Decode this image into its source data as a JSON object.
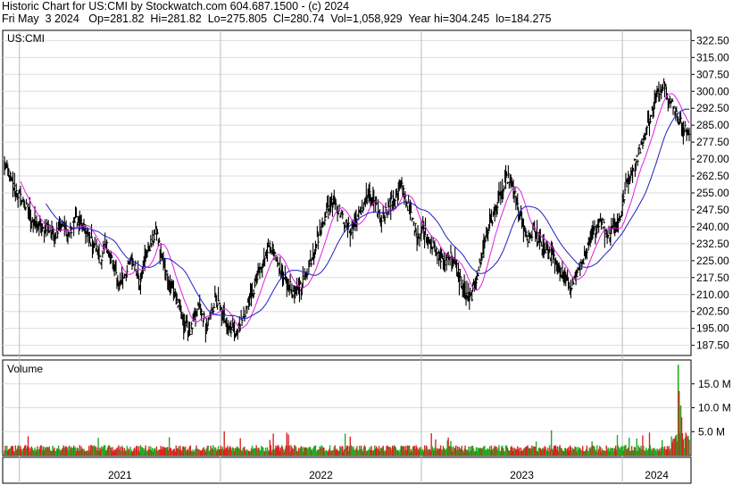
{
  "header": {
    "line1": "Historic Chart for US:CMI by Stockwatch.com 604.687.1500 - (c) 2024",
    "line2": "Fri May  3 2024   Op=281.82  Hi=281.82  Lo=275.805  Cl=280.74  Vol=1,058,929  Year hi=304.245  lo=184.275"
  },
  "chart_data": {
    "type": "line",
    "symbol": "US:CMI",
    "price_axis": {
      "range": [
        183,
        327
      ],
      "ticks": [
        "322.50",
        "315.00",
        "307.50",
        "300.00",
        "292.50",
        "285.00",
        "277.50",
        "270.00",
        "262.50",
        "255.00",
        "247.50",
        "240.00",
        "232.50",
        "225.00",
        "217.50",
        "210.00",
        "202.50",
        "195.00",
        "187.50"
      ]
    },
    "volume_axis": {
      "title": "Volume",
      "range": [
        0,
        20000000
      ],
      "ticks": [
        "15.0 M",
        "10.0 M",
        "5.0 M"
      ]
    },
    "x_axis": {
      "labels": [
        "2021",
        "2022",
        "2023",
        "2024"
      ]
    },
    "grid": true,
    "price_series_weekly": {
      "name": "US:CMI",
      "start": "2020-12",
      "end": "2024-05-03",
      "close": [
        268,
        264,
        258,
        255,
        252,
        249,
        245,
        242,
        240,
        238,
        241,
        238,
        236,
        242,
        240,
        236,
        239,
        244,
        241,
        238,
        235,
        232,
        229,
        226,
        232,
        228,
        222,
        214,
        218,
        220,
        226,
        222,
        216,
        225,
        230,
        234,
        238,
        228,
        222,
        215,
        212,
        206,
        200,
        196,
        194,
        199,
        205,
        200,
        196,
        202,
        208,
        204,
        200,
        196,
        195,
        193,
        198,
        202,
        208,
        212,
        218,
        223,
        230,
        232,
        226,
        220,
        218,
        215,
        212,
        210,
        214,
        218,
        222,
        228,
        234,
        240,
        246,
        250,
        252,
        248,
        244,
        240,
        238,
        242,
        246,
        250,
        254,
        252,
        248,
        244,
        246,
        250,
        252,
        255,
        258,
        252,
        246,
        240,
        236,
        240,
        236,
        232,
        229,
        226,
        224,
        228,
        226,
        222,
        216,
        210,
        207,
        212,
        220,
        228,
        236,
        242,
        246,
        252,
        256,
        262,
        258,
        252,
        245,
        238,
        234,
        238,
        236,
        232,
        230,
        228,
        226,
        222,
        218,
        216,
        214,
        217,
        222,
        226,
        230,
        235,
        240,
        244,
        239,
        236,
        242,
        240,
        247,
        258,
        263,
        268,
        272,
        278,
        284,
        290,
        296,
        301,
        304,
        298,
        294,
        290,
        286,
        283,
        281
      ],
      "ma_fast": {
        "color": "#e020e0"
      },
      "ma_slow": {
        "color": "#2020c0"
      }
    },
    "volume_colors": {
      "up": "#22aa22",
      "down": "#dd2222"
    },
    "volume_spikes_2024": [
      {
        "value": 19000000
      },
      {
        "value": 13500000
      },
      {
        "value": 10500000
      },
      {
        "value": 8000000
      }
    ]
  }
}
